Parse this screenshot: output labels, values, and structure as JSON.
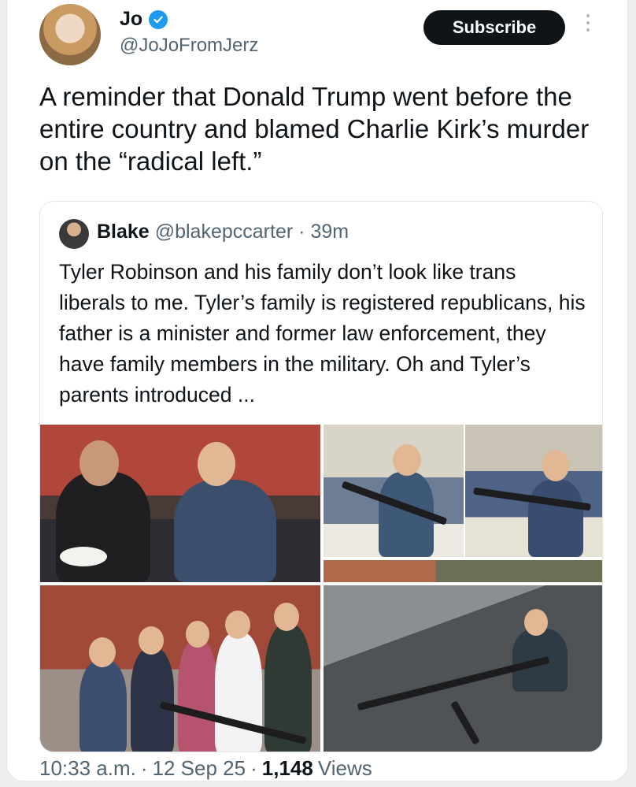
{
  "author": {
    "name": "Jo",
    "handle": "@JoJoFromJerz",
    "verified": true
  },
  "subscribe_label": "Subscribe",
  "tweet_text": "A reminder that Donald Trump went before the entire country and blamed Charlie Kirk’s murder on the “radical left.”",
  "quoted": {
    "name": "Blake",
    "handle": "@blakepccarter",
    "separator": "·",
    "time": "39m",
    "text": "Tyler Robinson and his family don’t look like trans liberals to me. Tyler’s family is registered republicans, his father is a minister and former law enforcement, they have family members in the military. Oh and Tyler’s parents introduced ..."
  },
  "footer": {
    "time": "10:33 a.m.",
    "dot1": "·",
    "date": "12 Sep 25",
    "dot2": "·",
    "views_count": "1,148",
    "views_label": "Views"
  },
  "colors": {
    "verified": "#1d9bf0",
    "subscribe_bg": "#0f1419",
    "secondary_text": "#536471"
  },
  "icons": [
    "verified-badge-icon",
    "more-options-icon"
  ]
}
